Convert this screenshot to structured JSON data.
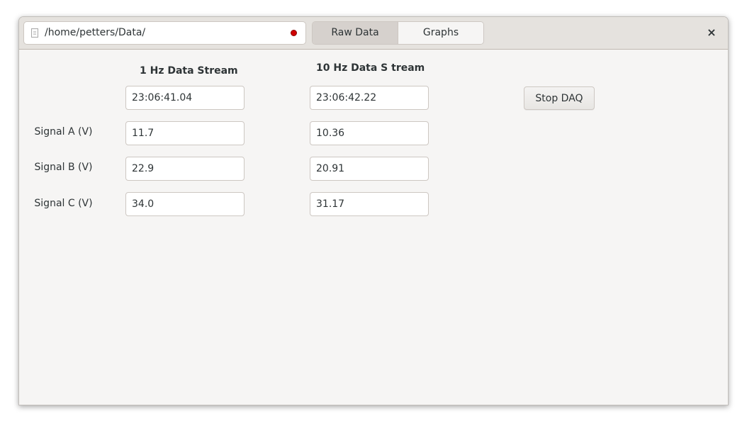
{
  "header": {
    "path": "/home/petters/Data/",
    "tabs": [
      {
        "label": "Raw Data",
        "active": true
      },
      {
        "label": "Graphs",
        "active": false
      }
    ],
    "close_label": "×",
    "recording_indicator_color": "#d00000"
  },
  "columns": {
    "stream_1hz": "1 Hz Data Stream",
    "stream_10hz": "10 Hz Data S tream"
  },
  "timestamps": {
    "stream_1hz": "23:06:41.04",
    "stream_10hz": "23:06:42.22"
  },
  "rows": [
    {
      "label": "Signal A (V)",
      "value_1hz": "11.7",
      "value_10hz": "10.36"
    },
    {
      "label": "Signal B (V)",
      "value_1hz": "22.9",
      "value_10hz": "20.91"
    },
    {
      "label": "Signal C (V)",
      "value_1hz": "34.0",
      "value_10hz": "31.17"
    }
  ],
  "actions": {
    "stop_label": "Stop DAQ"
  }
}
